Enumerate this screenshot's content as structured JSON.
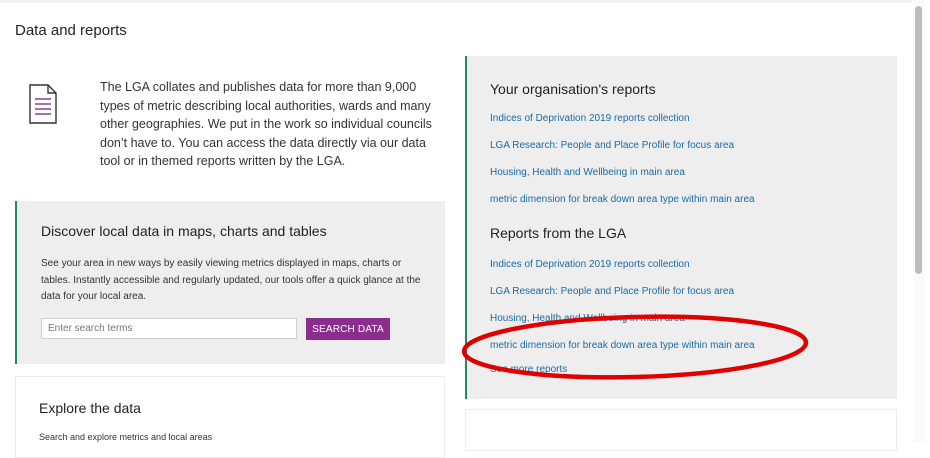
{
  "page": {
    "title": "Data and reports"
  },
  "intro": {
    "icon": "document-icon",
    "text": "The LGA collates and publishes data for more than 9,000 types of metric describing local authorities, wards and many other geographies. We put in the work so individual councils don’t have to. You can access the data directly via our data tool or in themed reports written by the LGA."
  },
  "discover": {
    "title": "Discover local data in maps, charts and tables",
    "description": "See your area in new ways by easily viewing metrics displayed in maps, charts or tables. Instantly accessible and regularly updated, our tools offer a quick glance at the data for your local area.",
    "search_placeholder": "Enter search terms",
    "search_button": "SEARCH DATA"
  },
  "explore": {
    "title": "Explore the data",
    "cut_text": "Search and explore metrics and local areas"
  },
  "reports": {
    "org_title": "Your organisation's reports",
    "org_links": [
      "Indices of Deprivation 2019 reports collection",
      "LGA Research: People and Place Profile for focus area",
      "Housing, Health and Wellbeing in main area",
      "metric dimension for break down area type within main area"
    ],
    "lga_title": "Reports from the LGA",
    "lga_links": [
      "Indices of Deprivation 2019 reports collection",
      "LGA Research: People and Place Profile for focus area",
      "Housing, Health and Wellbeing in main area",
      "metric dimension for break down area type within main area"
    ],
    "see_more": "See more reports"
  },
  "colors": {
    "accent": "#8a2d8c",
    "link": "#1b6aa5",
    "panel_border": "#1f8a70",
    "annotation": "#e00000"
  }
}
